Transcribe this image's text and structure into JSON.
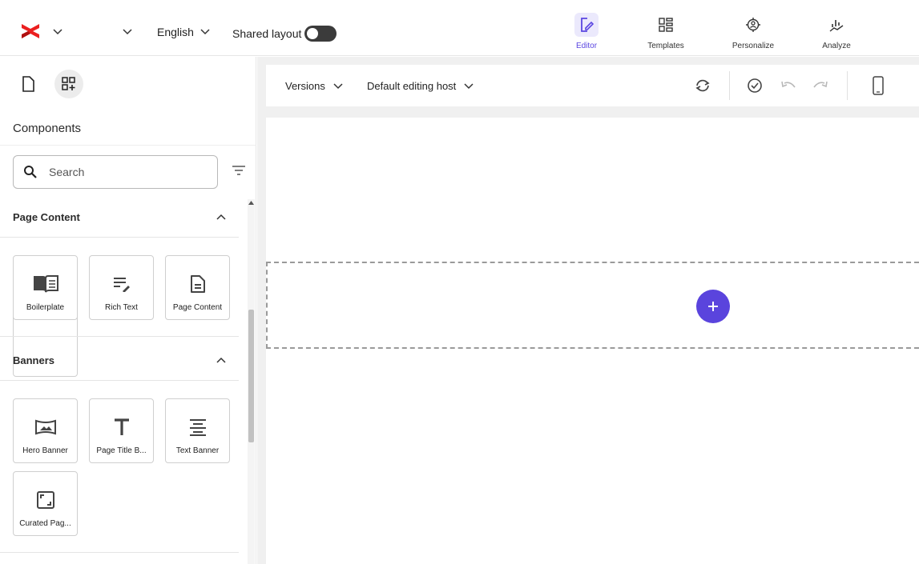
{
  "topbar": {
    "language": "English",
    "shared_layout_label": "Shared layout",
    "nav": [
      {
        "label": "Editor",
        "icon": "editor-icon",
        "active": true
      },
      {
        "label": "Templates",
        "icon": "templates-icon"
      },
      {
        "label": "Personalize",
        "icon": "personalize-icon"
      },
      {
        "label": "Analyze",
        "icon": "analyze-icon"
      }
    ]
  },
  "leftpanel": {
    "title": "Components",
    "search_placeholder": "Search",
    "sections": [
      {
        "title": "Page Content",
        "items": [
          "Boilerplate",
          "Rich Text",
          "Page Content"
        ]
      },
      {
        "title": "Banners",
        "items": [
          "Hero Banner",
          "Page Title B...",
          "Text Banner",
          "Curated Pag..."
        ]
      }
    ]
  },
  "toolbar": {
    "versions_label": "Versions",
    "host_label": "Default editing host"
  },
  "colors": {
    "accent": "#5a44dd",
    "accent_bg": "#ebe9fc",
    "logo_red": "#eb1f1f"
  }
}
